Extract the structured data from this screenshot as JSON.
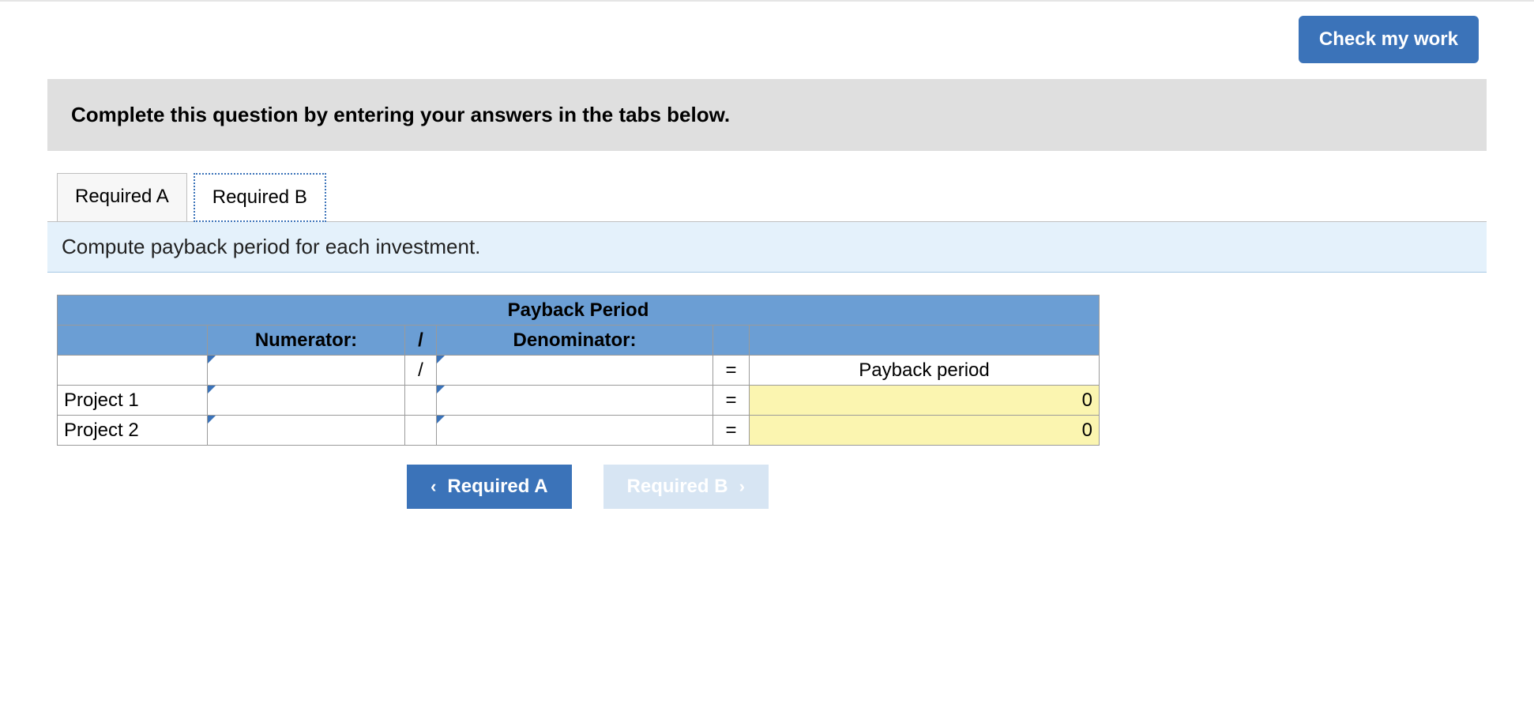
{
  "topbar": {
    "check_button": "Check my work"
  },
  "instruction": "Complete this question by entering your answers in the tabs below.",
  "tabs": {
    "a": "Required A",
    "b": "Required B"
  },
  "panel_heading": "Compute payback period for each investment.",
  "table": {
    "title": "Payback Period",
    "numerator_header": "Numerator:",
    "denominator_header": "Denominator:",
    "slash": "/",
    "equals": "=",
    "result_label": "Payback period",
    "rows": [
      {
        "label": "Project 1",
        "result": "0"
      },
      {
        "label": "Project 2",
        "result": "0"
      }
    ]
  },
  "nav": {
    "prev": "Required A",
    "next": "Required B"
  }
}
